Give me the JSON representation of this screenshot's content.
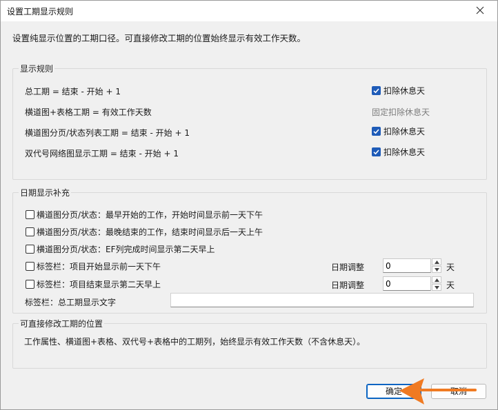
{
  "window": {
    "title": "设置工期显示规则"
  },
  "description": "设置纯显示位置的工期口径。可直接修改工期的位置始终显示有效工作天数。",
  "display_rules": {
    "title": "显示规则",
    "rules": [
      {
        "label": "总工期 = 结束 - 开始 + 1",
        "option": "扣除休息天",
        "checked": true
      },
      {
        "label": "横道图+表格工期 = 有效工作天数",
        "option": "固定扣除休息天",
        "checked": null
      },
      {
        "label": "横道图分页/状态列表工期 = 结束 - 开始 + 1",
        "option": "扣除休息天",
        "checked": true
      },
      {
        "label": "双代号网络图显示工期 = 结束 - 开始 + 1",
        "option": "扣除休息天",
        "checked": true
      }
    ]
  },
  "date_supplement": {
    "title": "日期显示补充",
    "options": [
      {
        "label": "横道图分页/状态：最早开始的工作，开始时间显示前一天下午",
        "checked": false
      },
      {
        "label": "横道图分页/状态：最晚结束的工作，结束时间显示后一天上午",
        "checked": false
      },
      {
        "label": "横道图分页/状态：EF列完成时间显示第二天早上",
        "checked": false
      },
      {
        "label": "标签栏：项目开始显示前一天下午",
        "checked": false,
        "adjust_label": "日期调整",
        "adjust_value": "0",
        "unit": "天"
      },
      {
        "label": "标签栏：项目结束显示第二天早上",
        "checked": false,
        "adjust_label": "日期调整",
        "adjust_value": "0",
        "unit": "天"
      }
    ],
    "total_text_label": "标签栏：总工期显示文字",
    "total_text_value": ""
  },
  "editable_positions": {
    "title": "可直接修改工期的位置",
    "text": "工作属性、横道图+表格、双代号+表格中的工期列，始终显示有效工作天数（不含休息天）。"
  },
  "buttons": {
    "ok": "确定",
    "cancel": "取消"
  },
  "colors": {
    "accent": "#1e5bb8",
    "arrow": "#f07a22",
    "dialog_bg": "#f0f0f0"
  }
}
